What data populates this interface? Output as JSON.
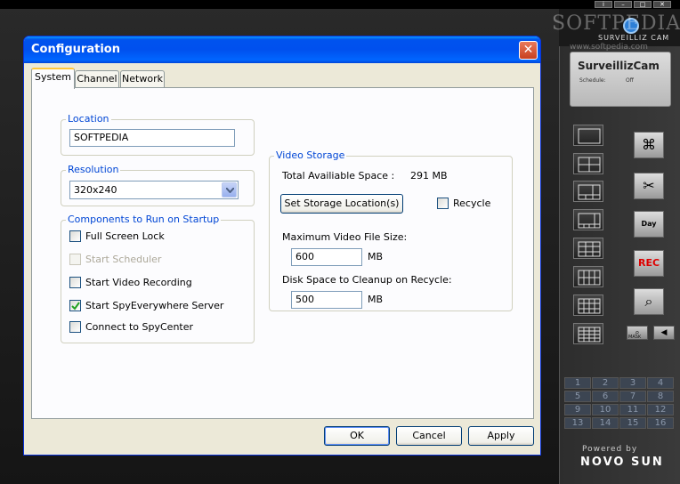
{
  "background_app": {
    "watermark": "SOFTPEDIA",
    "watermark_url": "www.softpedia.com",
    "logo_text": "SURVEILLIZ CAM",
    "lcd": {
      "title": "SurveillizCam",
      "schedule_label": "Schedule:",
      "schedule_value": "Off"
    },
    "window_buttons": [
      "i",
      "–",
      "□",
      "✕"
    ],
    "day_label": "Day",
    "rec_label": "REC",
    "small_label": "MASK",
    "channels": [
      "1",
      "2",
      "3",
      "4",
      "5",
      "6",
      "7",
      "8",
      "9",
      "10",
      "11",
      "12",
      "13",
      "14",
      "15",
      "16"
    ],
    "powered_by": "Powered by",
    "brand": "NOVO SUN"
  },
  "dialog": {
    "title": "Configuration",
    "close_glyph": "✕",
    "tabs": [
      {
        "label": "System",
        "active": true
      },
      {
        "label": "Channel",
        "active": false
      },
      {
        "label": "Network",
        "active": false
      }
    ],
    "location": {
      "label": "Location",
      "value": "SOFTPEDIA"
    },
    "resolution": {
      "label": "Resolution",
      "value": "320x240"
    },
    "startup": {
      "label": "Components to Run on Startup",
      "items": [
        {
          "label": "Full Screen Lock",
          "checked": false,
          "enabled": true
        },
        {
          "label": "Start Scheduler",
          "checked": false,
          "enabled": false
        },
        {
          "label": "Start Video Recording",
          "checked": false,
          "enabled": true
        },
        {
          "label": "Start SpyEverywhere Server",
          "checked": true,
          "enabled": true
        },
        {
          "label": "Connect to SpyCenter",
          "checked": false,
          "enabled": true
        }
      ]
    },
    "video_storage": {
      "label": "Video Storage",
      "total_space_label": "Total Availiable Space :",
      "total_space_value": "291 MB",
      "set_location_button": "Set Storage Location(s)",
      "recycle_label": "Recycle",
      "recycle_checked": false,
      "max_file_label": "Maximum Video File Size:",
      "max_file_value": "600",
      "max_file_unit": "MB",
      "cleanup_label": "Disk Space to Cleanup on Recycle:",
      "cleanup_value": "500",
      "cleanup_unit": "MB"
    },
    "buttons": {
      "ok": "OK",
      "cancel": "Cancel",
      "apply": "Apply"
    }
  }
}
